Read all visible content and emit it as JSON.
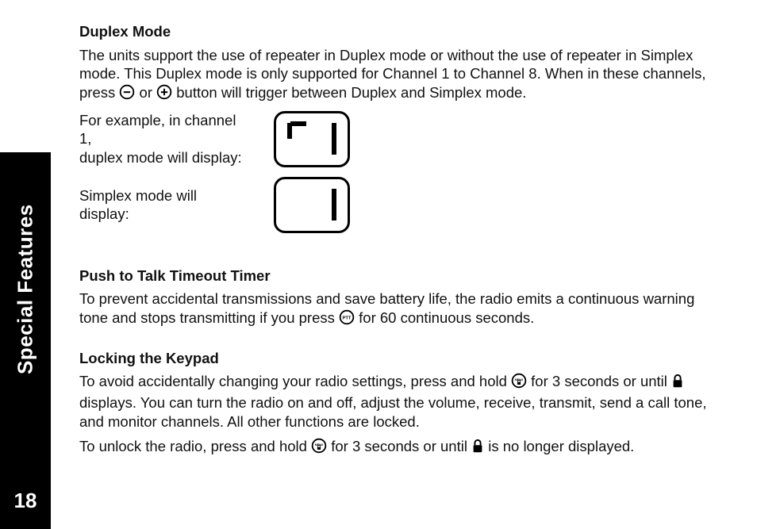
{
  "sidebar": {
    "label": "Special Features",
    "page_number": "18"
  },
  "sections": {
    "duplex": {
      "heading": "Duplex Mode",
      "p1_part1": "The units support the use of repeater in Duplex mode or without the use of repeater in Simplex mode. This Duplex mode is only supported for Channel 1 to Channel 8. When in these channels, press ",
      "p1_or": " or ",
      "p1_part2": " button will trigger between Duplex and Simplex mode.",
      "example_duplex_line1": "For example, in channel 1,",
      "example_duplex_line2": "duplex mode will display:",
      "example_simplex": "Simplex mode will display:"
    },
    "ptt": {
      "heading": "Push to Talk Timeout Timer",
      "p1_part1": "To prevent accidental transmissions and save battery life, the radio emits a continuous warning tone and stops transmitting if you press ",
      "p1_part2": " for 60 continuous seconds."
    },
    "lock": {
      "heading": "Locking the Keypad",
      "p1_part1": "To avoid accidentally changing your radio settings, press and hold ",
      "p1_part2": " for 3 seconds or until ",
      "p1_part3": " displays. You can turn the radio on and off, adjust the volume, receive, transmit, send a call tone, and monitor channels. All other functions are locked.",
      "p2_part1": "To unlock the radio, press and hold ",
      "p2_part2": " for 3 seconds or until ",
      "p2_part3": " is no longer displayed."
    }
  },
  "icons": {
    "minus": "−",
    "plus": "+",
    "ptt": "PTT",
    "menu": "MENU"
  }
}
